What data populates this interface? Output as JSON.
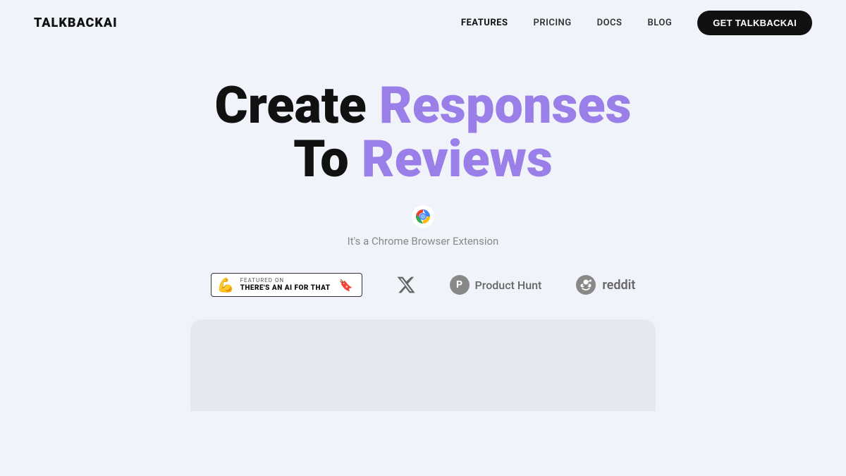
{
  "brand": {
    "logo": "TALKBACKAI"
  },
  "nav": {
    "links": [
      {
        "label": "FEATURES",
        "active": true
      },
      {
        "label": "PRICING",
        "active": false
      },
      {
        "label": "DOCS",
        "active": false
      },
      {
        "label": "BLOG",
        "active": false
      }
    ],
    "cta": "GET TALKBACKAI"
  },
  "hero": {
    "headline_line1_black": "Create",
    "headline_line1_purple": "Responses",
    "headline_line2_black": "To",
    "headline_line2_purple": "Reviews",
    "subtitle": "It's a Chrome Browser Extension"
  },
  "logos": {
    "ai_badge": {
      "featured_label": "FEATURED ON",
      "name": "THERE'S AN AI FOR THAT"
    },
    "product_hunt_label": "Product Hunt",
    "reddit_label": "reddit"
  },
  "colors": {
    "purple": "#9b7fe8",
    "black": "#111",
    "cta_bg": "#111",
    "cta_text": "#fff",
    "bg": "#f0f3f9"
  }
}
